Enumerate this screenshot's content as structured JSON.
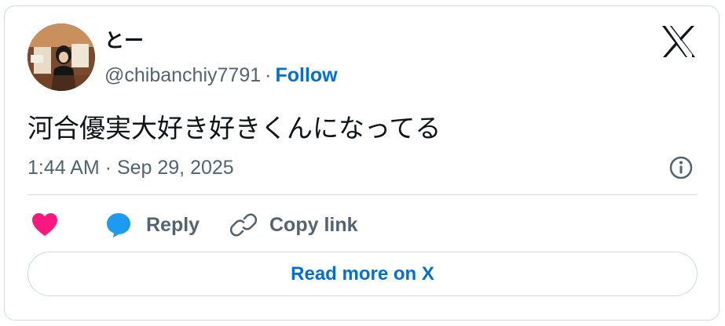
{
  "author": {
    "display_name": "とー",
    "handle": "@chibanchiy7791",
    "separator": "·",
    "follow_label": "Follow"
  },
  "tweet": {
    "text": "河合優実大好き好きくんになってる",
    "timestamp": "1:44 AM · Sep 29, 2025"
  },
  "actions": {
    "reply_label": "Reply",
    "copy_link_label": "Copy link"
  },
  "footer": {
    "read_more_label": "Read more on X"
  },
  "icons": {
    "brand": "x-logo-icon",
    "info": "info-icon",
    "like": "heart-icon",
    "reply": "reply-bubble-icon",
    "link": "link-icon"
  },
  "colors": {
    "link_blue": "#006fd6",
    "heart": "#f91880",
    "reply_bubble": "#1d9bf0",
    "muted": "#536471",
    "border": "#cfd9de"
  }
}
